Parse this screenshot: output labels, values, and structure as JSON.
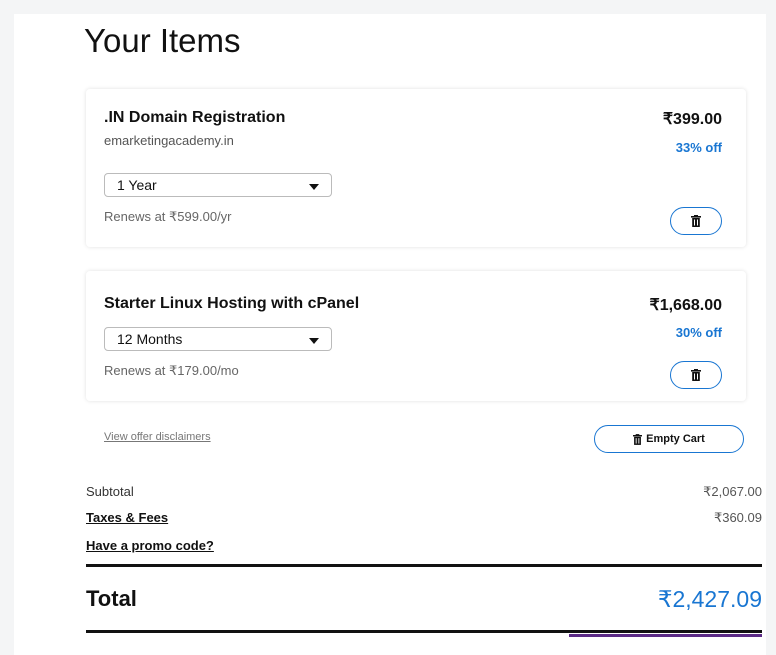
{
  "heading": "Your Items",
  "items": [
    {
      "title": ".IN Domain Registration",
      "subtitle": "emarketingacademy.in",
      "term": "1 Year",
      "renews": "Renews at ₹599.00/yr",
      "price": "₹399.00",
      "discount": "33% off"
    },
    {
      "title": "Starter Linux Hosting with cPanel",
      "term": "12 Months",
      "renews": "Renews at ₹179.00/mo",
      "price": "₹1,668.00",
      "discount": "30% off"
    }
  ],
  "disclaimer_link": "View offer disclaimers",
  "empty_cart_label": "Empty Cart",
  "summary": {
    "subtotal_label": "Subtotal",
    "subtotal_value": "₹2,067.00",
    "taxes_label": "Taxes & Fees",
    "taxes_value": "₹360.09",
    "promo_label": "Have a promo code?",
    "total_label": "Total",
    "total_value": "₹2,427.09"
  },
  "colors": {
    "accent": "#1976d2",
    "strip": "#5b2a86"
  },
  "icons": [
    "trash-icon",
    "chevron-down-icon"
  ]
}
